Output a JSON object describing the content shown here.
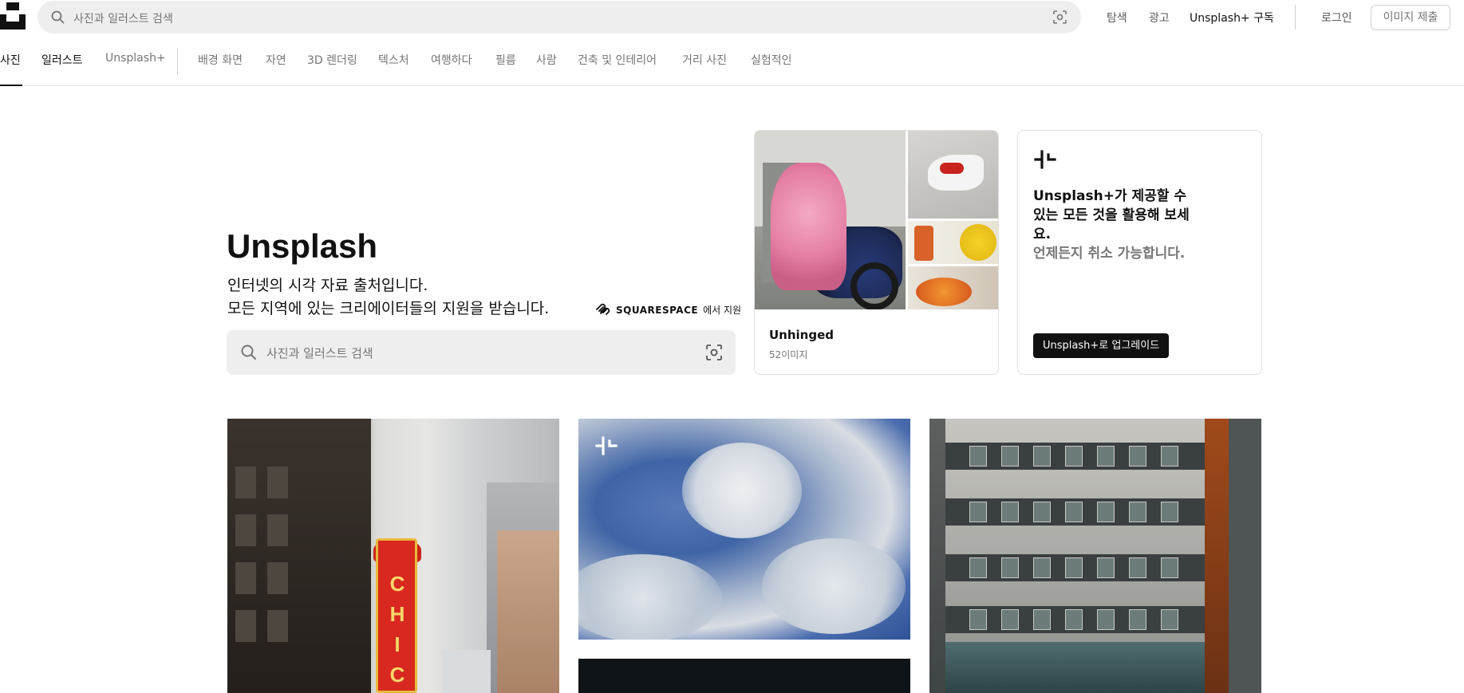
{
  "header": {
    "search_placeholder": "사진과 일러스트 검색",
    "nav": {
      "explore": "탐색",
      "advertise": "광고",
      "unsplash_plus": "Unsplash+ 구독"
    },
    "login": "로그인",
    "submit": "이미지 제출"
  },
  "categories": {
    "tabs": [
      "사진",
      "일러스트",
      "Unsplash+"
    ],
    "topics": [
      "배경 화면",
      "자연",
      "3D 렌더링",
      "텍스처",
      "여행하다",
      "필름",
      "사람",
      "건축 및 인테리어",
      "거리 사진",
      "실험적인"
    ]
  },
  "hero": {
    "title": "Unsplash",
    "line1": "인터넷의 시각 자료 출처입니다.",
    "line2": "모든 지역에 있는 크리에이터들의 지원을 받습니다.",
    "sponsor_name": "SQUARESPACE",
    "sponsor_suffix": "에서 지원",
    "search_placeholder": "사진과 일러스트 검색"
  },
  "collection": {
    "title": "Unhinged",
    "count": "52이미지"
  },
  "promo": {
    "headline": "Unsplash+가 제공할 수 있는 모든 것을 활용해 보세요.",
    "subline": "언제든지 취소 가능합니다.",
    "button": "Unsplash+로 업그레이드"
  },
  "photos": {
    "chicago_sign_text": "CHICA"
  },
  "colors": {
    "search_bg": "#eeeeee",
    "text_primary": "#111111",
    "text_muted": "#767676",
    "button_dark": "#111111"
  }
}
